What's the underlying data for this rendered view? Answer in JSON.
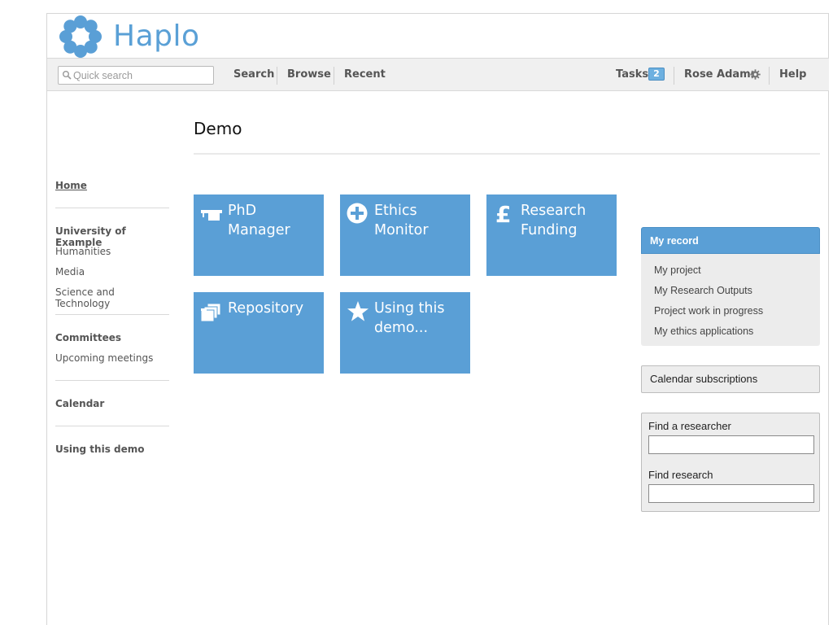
{
  "app": {
    "logo_text": "Haplo",
    "brand_color": "#5a9fd6"
  },
  "topbar": {
    "search_placeholder": "Quick search",
    "search_value": "",
    "links": [
      "Search",
      "Browse",
      "Recent"
    ],
    "tasks_label": "Tasks",
    "tasks_count": "2",
    "user_name": "Rose Adams",
    "help_label": "Help"
  },
  "page": {
    "title": "Demo"
  },
  "leftnav": {
    "home": "Home",
    "university": "University of Example",
    "departments": [
      "Humanities",
      "Media",
      "Science and Technology"
    ],
    "committees": "Committees",
    "upcoming": "Upcoming meetings",
    "calendar": "Calendar",
    "using": "Using this demo"
  },
  "tiles": [
    {
      "label": "PhD Manager",
      "icon": "mortarboard-icon"
    },
    {
      "label": "Ethics Monitor",
      "icon": "plus-circle-icon"
    },
    {
      "label": "Research Funding",
      "icon": "pound-icon"
    },
    {
      "label": "Repository",
      "icon": "folders-icon"
    },
    {
      "label": "Using this demo...",
      "icon": "star-icon"
    }
  ],
  "my_record": {
    "heading": "My record",
    "items": [
      "My project",
      "My Research Outputs",
      "Project work in progress",
      "My ethics applications"
    ]
  },
  "calendar_subscriptions": "Calendar subscriptions",
  "find": {
    "researcher_label": "Find a researcher",
    "researcher_value": "",
    "research_label": "Find research",
    "research_value": ""
  }
}
